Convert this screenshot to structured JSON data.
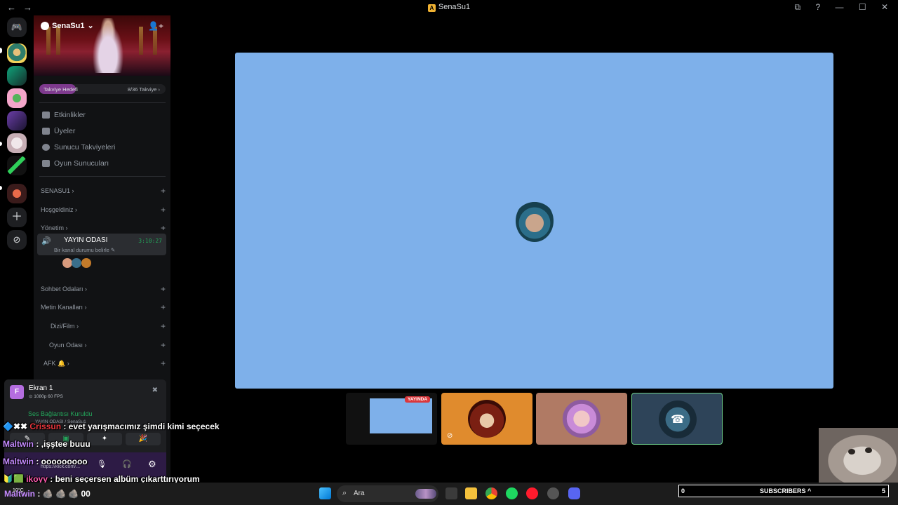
{
  "window": {
    "title": "SenaSu1",
    "badge": "A",
    "nav_back": "←",
    "nav_forward": "→",
    "controls": [
      "⧉",
      "?",
      "—",
      "☐",
      "✕"
    ]
  },
  "server": {
    "name": "SenaSu1",
    "dropdown": "⌄",
    "invite_icon": "👤+"
  },
  "boost": {
    "label": "Takviye Hedefi",
    "progress": "8/36 Takviye ›",
    "progress_fraction": 0.22
  },
  "nav_items": [
    {
      "label": "Etkinlikler"
    },
    {
      "label": "Üyeler"
    },
    {
      "label": "Sunucu Takviyeleri"
    },
    {
      "label": "Oyun Sunucuları"
    }
  ],
  "categories": [
    {
      "label": "SENASU1 ›"
    },
    {
      "label": "Hoşgeldiniz ›"
    },
    {
      "label": "Yönetim ›"
    },
    {
      "label": "Sohbet Odaları ›"
    },
    {
      "label": "Metin Kanalları ›"
    },
    {
      "label": "Dizi/Film ›"
    },
    {
      "label": "Oyun Odası ›"
    },
    {
      "label": "AFK 🔔 ›"
    }
  ],
  "voice_channel": {
    "name": "YAYIN ODASI",
    "timer": "3:10:27",
    "status": "Bir kanal durumu belirle ✎"
  },
  "screen_share": {
    "title": "Ekran 1",
    "quality": "⊙ 1080p 60 FPS",
    "avatar_letter": "F"
  },
  "voice_status": {
    "title": "Ses Bağlantısı Kuruldu",
    "subtitle": "YAYIN ODASI / SenaSu1"
  },
  "stage": {
    "live_badge": "YAYINDA"
  },
  "chat": [
    {
      "prefix": "🔷✖✖ ",
      "name": "Crissun",
      "text": " : evet yarışmacımız şimdi kimi seçecek"
    },
    {
      "prefix": "",
      "name": "Maltwin",
      "text": " : ,işştee buuu"
    },
    {
      "prefix": "",
      "name": "Maltwin",
      "text": " : ooooooooo"
    },
    {
      "prefix": "🔰🟩 ",
      "name": "ikoyy",
      "text": " : beni seçersen albüm çıkarttırıyorum"
    },
    {
      "prefix": "",
      "name": "Maltwin",
      "text": " : 🪨 🪨 🪨 00"
    }
  ],
  "stream_link": "https://kick.com/...",
  "taskbar": {
    "search_placeholder": "Ara",
    "weather": "10°C"
  },
  "subscribers": {
    "count_left": "0",
    "label": "SUBSCRIBERS",
    "caret": "^",
    "count_right": "5"
  },
  "colors": {
    "stage_tile": "#7eb0ea",
    "online": "#23a55a",
    "live": "#da373c",
    "boost": "#7e3a8e"
  }
}
